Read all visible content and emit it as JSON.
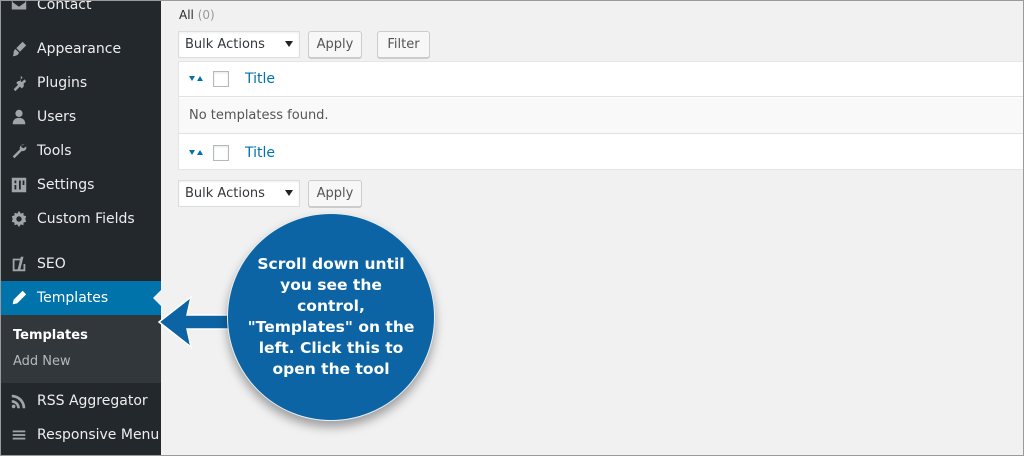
{
  "sidebar": {
    "items": [
      {
        "label": "Contact",
        "icon": "envelope-icon"
      },
      {
        "label": "Appearance",
        "icon": "paintbrush-icon"
      },
      {
        "label": "Plugins",
        "icon": "plugin-icon"
      },
      {
        "label": "Users",
        "icon": "user-icon"
      },
      {
        "label": "Tools",
        "icon": "wrench-icon"
      },
      {
        "label": "Settings",
        "icon": "settings-icon"
      },
      {
        "label": "Custom Fields",
        "icon": "gear-icon"
      },
      {
        "label": "SEO",
        "icon": "yoast-icon"
      },
      {
        "label": "Templates",
        "icon": "pencil-icon",
        "active": true
      },
      {
        "label": "RSS Aggregator",
        "icon": "rss-icon"
      },
      {
        "label": "Responsive Menu",
        "icon": "hamburger-icon"
      }
    ],
    "submenu": [
      {
        "label": "Templates",
        "current": true
      },
      {
        "label": "Add New"
      }
    ]
  },
  "main": {
    "views": {
      "all_label": "All",
      "all_count": "(0)"
    },
    "bulk_top": {
      "select_value": "Bulk Actions",
      "apply_label": "Apply",
      "filter_label": "Filter"
    },
    "table": {
      "column_title": "Title",
      "empty_message": "No templatess found."
    },
    "bulk_bottom": {
      "select_value": "Bulk Actions",
      "apply_label": "Apply"
    }
  },
  "callout": {
    "text": "Scroll down until you see the control, \"Templates\" on the left. Click this to open the tool"
  },
  "colors": {
    "sidebar_bg": "#23282d",
    "active_bg": "#0073aa",
    "callout_bg": "#0d64a4",
    "link": "#0073aa"
  }
}
